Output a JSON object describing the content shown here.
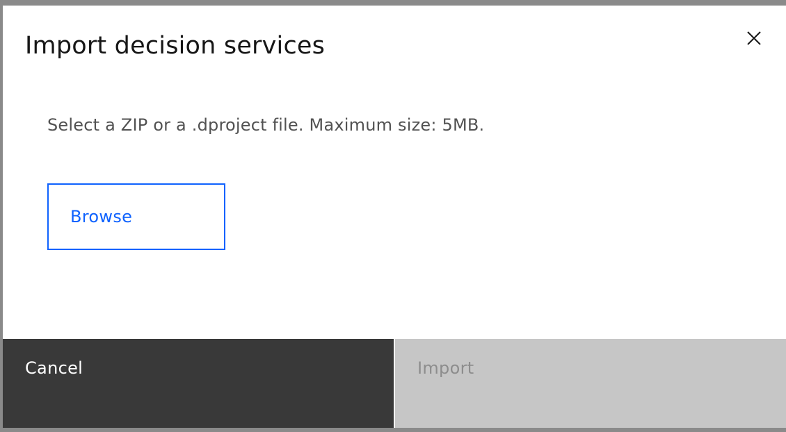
{
  "dialog": {
    "title": "Import decision services",
    "description": "Select a ZIP or a .dproject file. Maximum size: 5MB.",
    "close_icon": "close-icon"
  },
  "actions": {
    "browse_label": "Browse",
    "cancel_label": "Cancel",
    "import_label": "Import",
    "import_disabled": true
  },
  "colors": {
    "accent": "#0f62fe",
    "cancel_bg": "#393939",
    "import_disabled_bg": "#c6c6c6",
    "import_disabled_text": "#8d8d8d"
  }
}
